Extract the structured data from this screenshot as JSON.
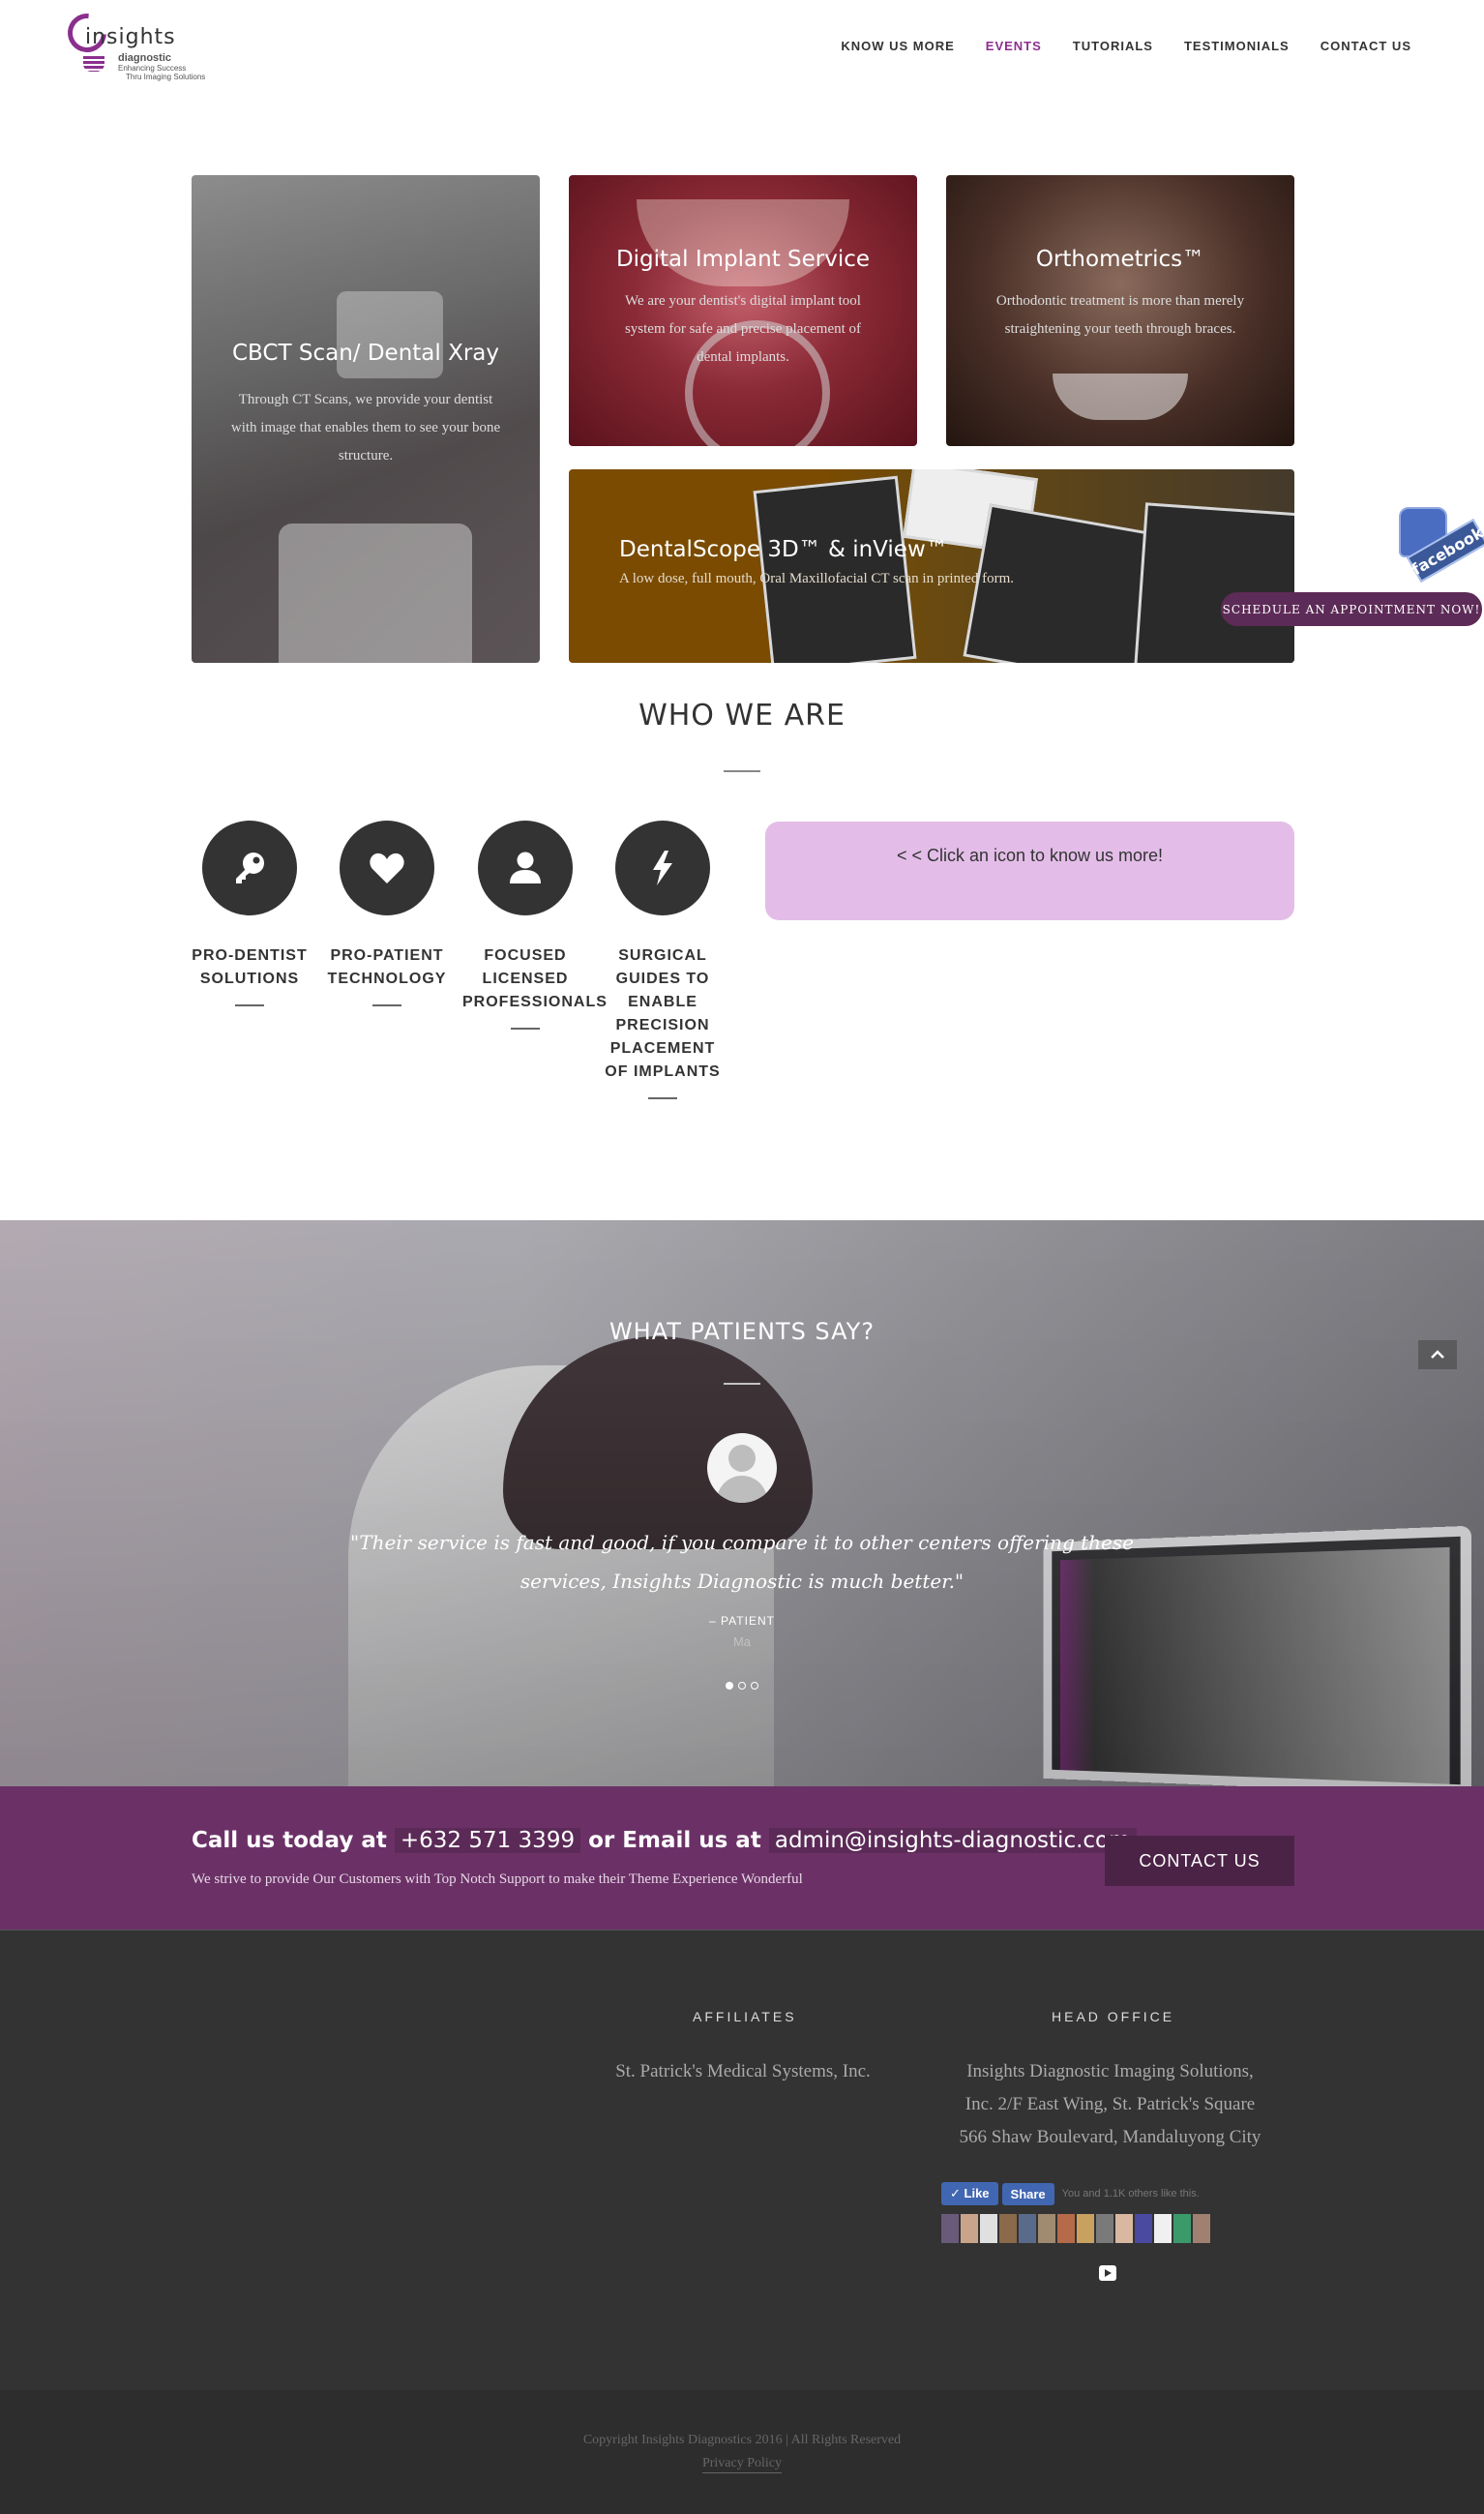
{
  "logo": {
    "name": "insights",
    "sub": "diagnostic",
    "tagline1": "Enhancing Success",
    "tagline2": "Thru Imaging Solutions"
  },
  "nav": [
    {
      "label": "KNOW US MORE",
      "active": false
    },
    {
      "label": "EVENTS",
      "active": true
    },
    {
      "label": "TUTORIALS",
      "active": false
    },
    {
      "label": "TESTIMONIALS",
      "active": false
    },
    {
      "label": "CONTACT US",
      "active": false
    }
  ],
  "services": {
    "cbct": {
      "title": "CBCT Scan/ Dental Xray",
      "text": "Through CT Scans, we provide your dentist with image that enables them to see your bone structure."
    },
    "implant": {
      "title": "Digital Implant Service",
      "text": "We are your dentist's digital implant tool system for safe and precise placement of dental implants."
    },
    "ortho": {
      "title": "Orthometrics™",
      "text": "Orthodontic treatment is more than merely straightening your teeth through braces."
    },
    "dental": {
      "title": "DentalScope 3D™ & inView™",
      "text": "A low dose, full mouth, Oral Maxillofacial CT scan in printed form."
    }
  },
  "facebook_badge": "facebook",
  "schedule_button": "SCHEDULE AN APPOINTMENT NOW!",
  "who": {
    "title": "WHO WE ARE",
    "features": [
      {
        "label": "PRO-DENTIST SOLUTIONS",
        "icon": "key-icon"
      },
      {
        "label": "PRO-PATIENT TECHNOLOGY",
        "icon": "heart-icon"
      },
      {
        "label": "FOCUSED LICENSED PROFESSIONALS",
        "icon": "user-icon"
      },
      {
        "label": "SURGICAL GUIDES TO ENABLE PRECISION PLACEMENT OF IMPLANTS",
        "icon": "bolt-icon"
      }
    ],
    "prompt": "< < Click an icon to know us more!"
  },
  "testimonials": {
    "title": "WHAT PATIENTS SAY?",
    "quote": "\"Their service is fast and good, if you compare it to other centers offering these services, Insights Diagnostic is much better.\"",
    "author": "– PATIENT",
    "name": "Ma",
    "slides": 3,
    "active_slide": 1
  },
  "call_band": {
    "call_prefix": "Call us today at",
    "phone": "+632 571 3399",
    "email_prefix": "or Email us at",
    "email": "admin@insights-diagnostic.com",
    "subtext": "We strive to provide Our Customers with Top Notch Support to make their Theme Experience Wonderful",
    "button": "CONTACT US"
  },
  "footer": {
    "affiliates_heading": "AFFILIATES",
    "affiliate": "St. Patrick's Medical Systems, Inc.",
    "office_heading": "HEAD OFFICE",
    "office_line1": "Insights Diagnostic Imaging Solutions,",
    "office_line2": "Inc. 2/F East Wing, St. Patrick's Square",
    "office_line3": "566 Shaw Boulevard, Mandaluyong City",
    "like_label": "Like",
    "share_label": "Share",
    "like_text": "You and 1.1K others like this.",
    "copyright": "Copyright Insights Diagnostics 2016 | All Rights Reserved",
    "privacy": "Privacy Policy"
  },
  "colors": {
    "brand": "#8b2f8e",
    "band": "#6b3167",
    "button_dark": "#4b2346",
    "know_box": "#e3bde8",
    "footer": "#333333"
  }
}
